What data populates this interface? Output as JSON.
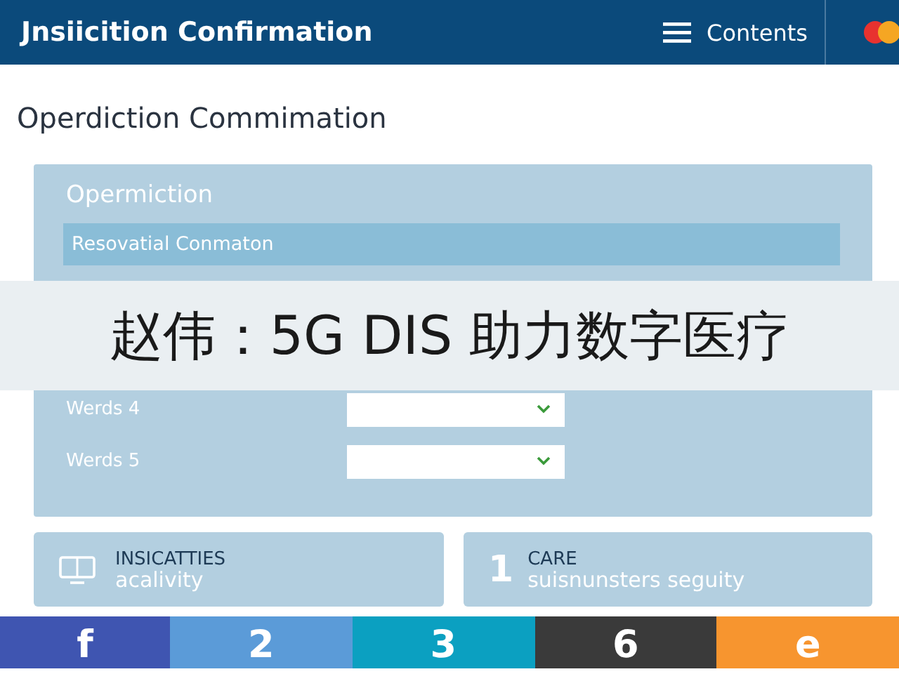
{
  "header": {
    "title": "Jnsiicition Confirmation",
    "menu_label": "Contents"
  },
  "page_heading": "Operdiction Commimation",
  "panel": {
    "title": "Opermiction",
    "section_bar": "Resovatial Conmaton",
    "rows": [
      {
        "label": "Werds 4"
      },
      {
        "label": "Werds 5"
      }
    ]
  },
  "banner": {
    "text": "赵伟：5G DIS 助力数字医疗"
  },
  "cards": [
    {
      "kind": "monitor",
      "heading": "INSICATTIES",
      "subtext": "acalivity"
    },
    {
      "kind": "number",
      "badge": "1",
      "heading": "CARE",
      "subtext": "suisnunsters seguity"
    }
  ],
  "share_bar": [
    {
      "label": "f",
      "color": "#3f55b1"
    },
    {
      "label": "2",
      "color": "#5b9bd8"
    },
    {
      "label": "3",
      "color": "#0ba0c1"
    },
    {
      "label": "6",
      "color": "#3a3a3a"
    },
    {
      "label": "e",
      "color": "#f7952f"
    }
  ]
}
